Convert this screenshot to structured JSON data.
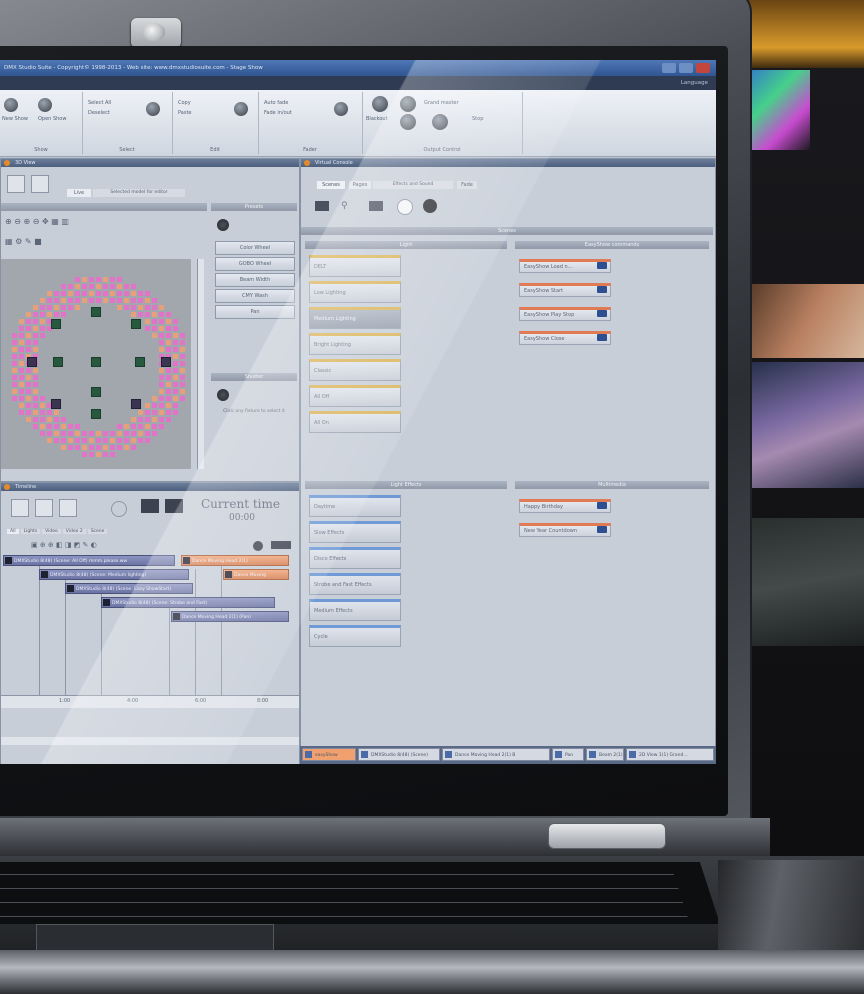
{
  "window": {
    "title": "DMX Studio Suite  -  Copyright© 1998-2013  -  Web site: www.dmxstudiosuite.com  -  Stage Show",
    "language_label": "Language"
  },
  "ribbon": {
    "groups": [
      {
        "label": "Show",
        "items": [
          "New Show",
          "Open Show"
        ]
      },
      {
        "label": "Select",
        "items": [
          "Select All",
          "Deselect"
        ]
      },
      {
        "label": "Edit",
        "items": [
          "Copy",
          "Paste"
        ]
      },
      {
        "label": "Fader",
        "items": [
          "Auto fade",
          "Fade in/out"
        ]
      },
      {
        "label": "Output Control",
        "items": [
          "Blackout",
          "Grand master",
          "Stop"
        ]
      }
    ]
  },
  "stage_panel": {
    "title": "3D View",
    "tab_live": "Live",
    "tab_extra": "Selected model for editor",
    "col_presets": "Presets",
    "preset_buttons": [
      "Color Wheel",
      "GOBO Wheel",
      "Beam Width",
      "CMY Wash",
      "Pan"
    ],
    "col_shutter": "Shutter",
    "shutter_hint": "Click any fixture to select it"
  },
  "cues_panel": {
    "title": "Virtual Console",
    "tabs": [
      "Scenes",
      "Pages",
      "Effects and Sound",
      "Fade"
    ],
    "section_header": "Scenes",
    "col_light": "Light",
    "col_easyshow": "EasyShow commands",
    "light_cues": [
      "DELT",
      "Low Lighting",
      "Medium Lighting",
      "Bright Lighting",
      "Classic",
      "All Off",
      "All On"
    ],
    "selected_cue": "Medium Lighting",
    "easyshow_cues": [
      "EasyShow Load n...",
      "EasyShow Start",
      "EasyShow Play Stop",
      "EasyShow Close"
    ],
    "col_effects": "Light Effects",
    "col_multimedia": "Multimedia",
    "effect_cues": [
      "Daytime",
      "Slow Effects",
      "Disco Effects",
      "Strobe and Fast Effects",
      "Medium Effects",
      "Cycle"
    ],
    "multimedia_cues": [
      "Happy Birthday",
      "New Year Countdown"
    ]
  },
  "timeline_panel": {
    "title": "Timeline",
    "current_time_label": "Current time",
    "current_time": "00:00",
    "tabs": [
      "All",
      "Lights",
      "Video",
      "Video 2",
      "Scene"
    ],
    "tracks": [
      "DMXStudio 8(48) (Scene: All Off) mmm.please.ww",
      "DMXStudio 8(48) (Scene: Medium lighting)",
      "DMXStudio 8(48) (Scene: Easy ShowStart)",
      "DMXStudio 8(48) (Scene: Strobe and Fast)",
      "Dance Moving Head 2(1) (Pan)"
    ],
    "orange_tracks": [
      "Dance Moving Head 2(1)",
      "Dance Moving"
    ],
    "ruler": [
      "1:00",
      "4:00",
      "6:00",
      "8:00"
    ]
  },
  "status_bar": {
    "items": [
      "easyShow",
      "DMXStudio 8(48) (Scene)",
      "Dance Moving Head 2(1) B",
      "Pan",
      "Beam 2(1)",
      "2D View 1(1) Grand..."
    ]
  },
  "colors": {
    "title_bar": "#2f5592",
    "panel": "#c7ced8",
    "cue_accent": "#d9b45a",
    "easyshow_accent": "#e07b55",
    "effect_accent": "#6f9ad6",
    "fixture_pixel_pink": "#e273c9",
    "fixture_pixel_orange": "#e8a07a",
    "fixture": "#27593f"
  },
  "icons": [
    "webcam-icon",
    "minimize-icon",
    "maximize-icon",
    "close-icon",
    "fixture-icon",
    "zoom-in-icon",
    "zoom-out-icon",
    "play-icon",
    "stop-icon"
  ]
}
